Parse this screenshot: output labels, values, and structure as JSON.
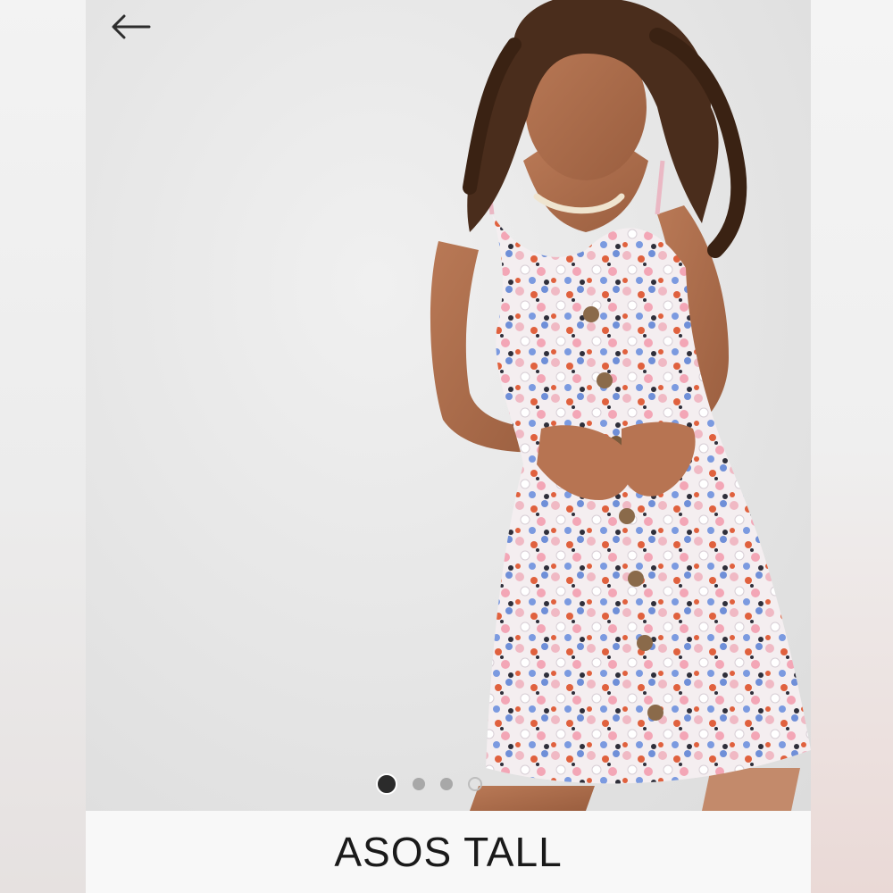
{
  "header": {
    "back_icon": "arrow-left-icon"
  },
  "carousel": {
    "slide_count": 4,
    "active_index": 0
  },
  "brand": {
    "name": "ASOS TALL"
  },
  "colors": {
    "background": "#efefef",
    "dot_active": "#2b2b2b",
    "dot_inactive": "#a8a8a8"
  }
}
